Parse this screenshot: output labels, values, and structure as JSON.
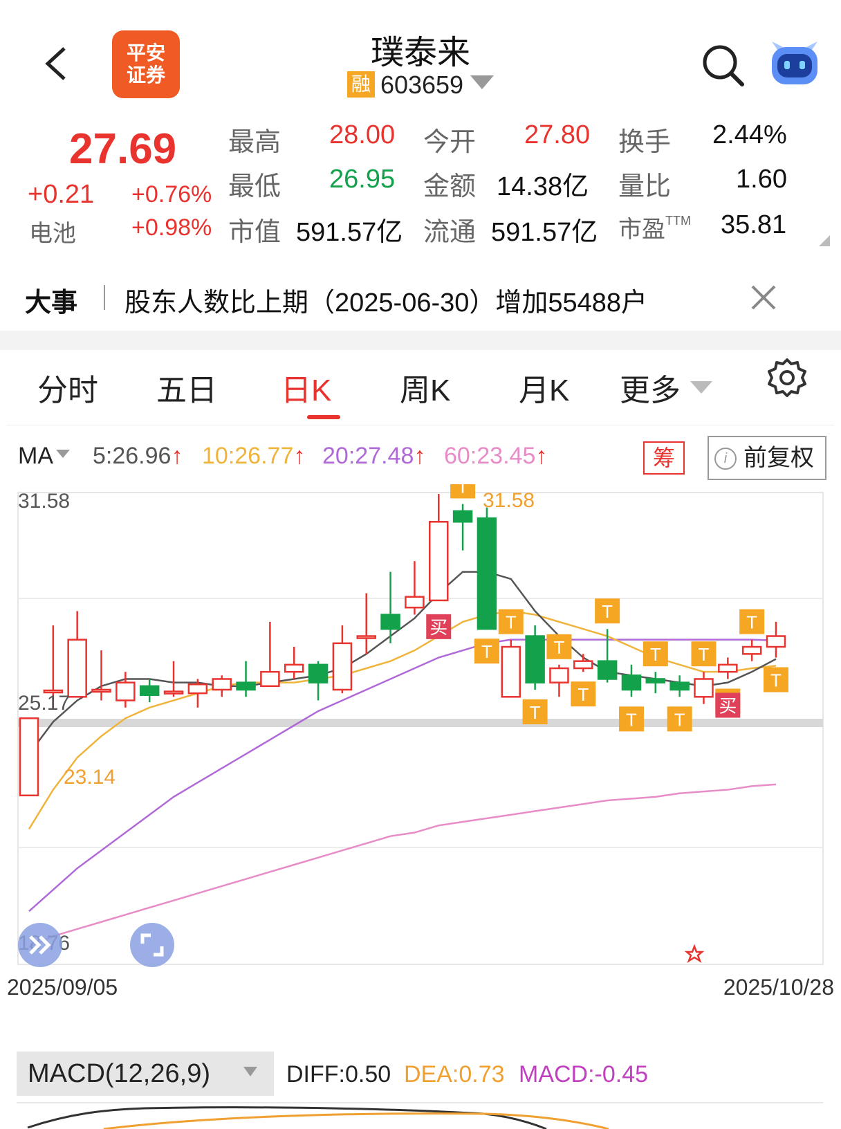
{
  "header": {
    "title": "璞泰来",
    "margin_badge": "融",
    "code": "603659",
    "logo_line1": "平安",
    "logo_line2": "证券"
  },
  "quote": {
    "price": "27.69",
    "change": "+0.21",
    "change_pct": "+0.76%",
    "sector": "电池",
    "sector_pct": "+0.98%",
    "items": [
      {
        "label": "最高",
        "value": "28.00"
      },
      {
        "label": "今开",
        "value": "27.80"
      },
      {
        "label": "换手",
        "value": "2.44%"
      },
      {
        "label": "最低",
        "value": "26.95"
      },
      {
        "label": "金额",
        "value": "14.38亿"
      },
      {
        "label": "量比",
        "value": "1.60"
      },
      {
        "label": "市值",
        "value": "591.57亿"
      },
      {
        "label": "流通",
        "value": "591.57亿"
      },
      {
        "label": "市盈",
        "value": "35.81",
        "sup": "TTM"
      }
    ]
  },
  "news": {
    "tag": "大事",
    "text": "股东人数比上期（2025-06-30）增加55488户"
  },
  "tabs": [
    {
      "label": "分时"
    },
    {
      "label": "五日"
    },
    {
      "label": "日K",
      "active": true
    },
    {
      "label": "周K"
    },
    {
      "label": "月K"
    },
    {
      "label": "更多"
    }
  ],
  "ma": {
    "label": "MA",
    "ma5": "5:26.96",
    "ma10": "10:26.77",
    "ma20": "20:27.48",
    "ma60": "60:23.45",
    "chip_label": "筹",
    "adjust_label": "前复权"
  },
  "colors": {
    "up": "#e8332e",
    "down": "#13a24b",
    "ma5": "#555555",
    "ma10": "#f0b43c",
    "ma20": "#b06ad8",
    "ma60": "#e88cc8",
    "t_marker": "#f5a623",
    "buy_marker": "#e0405a"
  },
  "chart_data": {
    "type": "candlestick",
    "y_max_label": "31.58",
    "y_mid_label": "25.17",
    "y_min_label": "18.76",
    "ylim": [
      18.76,
      31.58
    ],
    "x_start": "2025/09/05",
    "x_end": "2025/10/28",
    "high_annotation": "31.58",
    "low_annotation": "23.14",
    "candles": [
      {
        "o": 23.14,
        "c": 25.3,
        "h": 25.3,
        "l": 23.14
      },
      {
        "o": 26.08,
        "c": 26.08,
        "h": 27.9,
        "l": 25.6
      },
      {
        "o": 25.9,
        "c": 27.5,
        "h": 28.3,
        "l": 25.9
      },
      {
        "o": 26.1,
        "c": 26.1,
        "h": 27.2,
        "l": 25.8
      },
      {
        "o": 25.8,
        "c": 26.3,
        "h": 26.6,
        "l": 25.6
      },
      {
        "o": 26.2,
        "c": 25.95,
        "h": 26.4,
        "l": 25.75
      },
      {
        "o": 26.05,
        "c": 26.05,
        "h": 26.9,
        "l": 25.9
      },
      {
        "o": 26.0,
        "c": 26.25,
        "h": 26.4,
        "l": 25.6
      },
      {
        "o": 26.1,
        "c": 26.4,
        "h": 26.5,
        "l": 25.9
      },
      {
        "o": 26.3,
        "c": 26.1,
        "h": 26.9,
        "l": 25.9
      },
      {
        "o": 26.2,
        "c": 26.6,
        "h": 28.0,
        "l": 26.2
      },
      {
        "o": 26.6,
        "c": 26.8,
        "h": 27.3,
        "l": 26.4
      },
      {
        "o": 26.8,
        "c": 26.3,
        "h": 26.9,
        "l": 25.8
      },
      {
        "o": 26.1,
        "c": 27.4,
        "h": 27.9,
        "l": 26.0
      },
      {
        "o": 27.6,
        "c": 27.6,
        "h": 28.8,
        "l": 27.1
      },
      {
        "o": 28.2,
        "c": 27.8,
        "h": 29.4,
        "l": 27.4
      },
      {
        "o": 28.4,
        "c": 28.7,
        "h": 29.7,
        "l": 28.2
      },
      {
        "o": 28.6,
        "c": 30.8,
        "h": 31.58,
        "l": 28.6
      },
      {
        "o": 31.1,
        "c": 30.8,
        "h": 31.3,
        "l": 30.0
      },
      {
        "o": 30.9,
        "c": 27.8,
        "h": 31.2,
        "l": 27.8
      },
      {
        "o": 25.9,
        "c": 27.3,
        "h": 27.5,
        "l": 25.9
      },
      {
        "o": 27.6,
        "c": 26.3,
        "h": 27.9,
        "l": 26.1
      },
      {
        "o": 26.3,
        "c": 26.7,
        "h": 26.8,
        "l": 25.9
      },
      {
        "o": 26.7,
        "c": 26.9,
        "h": 27.1,
        "l": 26.6
      },
      {
        "o": 26.9,
        "c": 26.4,
        "h": 27.8,
        "l": 26.3
      },
      {
        "o": 26.5,
        "c": 26.1,
        "h": 26.8,
        "l": 25.9
      },
      {
        "o": 26.4,
        "c": 26.3,
        "h": 26.6,
        "l": 26.0
      },
      {
        "o": 26.3,
        "c": 26.1,
        "h": 26.5,
        "l": 25.9
      },
      {
        "o": 25.9,
        "c": 26.4,
        "h": 26.6,
        "l": 25.7
      },
      {
        "o": 26.6,
        "c": 26.8,
        "h": 27.0,
        "l": 26.4
      },
      {
        "o": 27.1,
        "c": 27.3,
        "h": 27.5,
        "l": 26.9
      },
      {
        "o": 27.3,
        "c": 27.6,
        "h": 28.0,
        "l": 27.0
      }
    ],
    "ma5": [
      24.3,
      25.2,
      25.8,
      26.2,
      26.4,
      26.4,
      26.3,
      26.3,
      26.2,
      26.2,
      26.3,
      26.4,
      26.5,
      26.7,
      27.1,
      27.6,
      28.1,
      28.8,
      29.4,
      29.4,
      29.2,
      28.3,
      27.6,
      27.0,
      26.6,
      26.5,
      26.4,
      26.3,
      26.2,
      26.3,
      26.6,
      26.96
    ],
    "ma10": [
      22.2,
      23.3,
      24.2,
      24.8,
      25.3,
      25.6,
      25.8,
      26.0,
      26.2,
      26.3,
      26.3,
      26.3,
      26.4,
      26.5,
      26.7,
      26.9,
      27.2,
      27.6,
      28.0,
      28.2,
      28.3,
      28.2,
      28.0,
      27.8,
      27.6,
      27.3,
      27.0,
      26.8,
      26.6,
      26.6,
      26.7,
      26.77
    ],
    "ma20": [
      19.9,
      20.5,
      21.1,
      21.6,
      22.1,
      22.6,
      23.1,
      23.5,
      23.9,
      24.3,
      24.7,
      25.1,
      25.5,
      25.8,
      26.1,
      26.4,
      26.7,
      27.0,
      27.2,
      27.4,
      27.5,
      27.5,
      27.5,
      27.5,
      27.5,
      27.5,
      27.5,
      27.5,
      27.5,
      27.5,
      27.5,
      27.48
    ],
    "ma60": [
      18.9,
      19.2,
      19.4,
      19.6,
      19.8,
      20.0,
      20.2,
      20.4,
      20.6,
      20.8,
      21.0,
      21.2,
      21.4,
      21.6,
      21.8,
      22.0,
      22.1,
      22.3,
      22.4,
      22.5,
      22.6,
      22.7,
      22.8,
      22.9,
      23.0,
      23.05,
      23.1,
      23.2,
      23.25,
      23.3,
      23.4,
      23.45
    ],
    "t_markers": [
      18,
      19,
      20,
      21,
      22,
      23,
      24,
      25,
      26,
      27,
      28,
      29,
      30,
      31
    ],
    "buy_markers": [
      17,
      29
    ],
    "t_label": "T",
    "buy_label": "买"
  },
  "macd": {
    "title": "MACD(12,26,9)",
    "diff": "DIFF:0.50",
    "dea": "DEA:0.73",
    "macd": "MACD:-0.45"
  }
}
